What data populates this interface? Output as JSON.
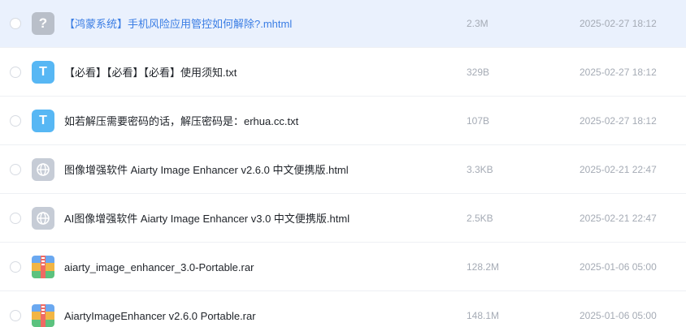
{
  "files": [
    {
      "name": "【鸿蒙系统】手机风险应用管控如何解除?.mhtml",
      "size": "2.3M",
      "date": "2025-02-27 18:12",
      "icon": "unknown-file-icon",
      "selected": true
    },
    {
      "name": "【必看】【必看】【必看】使用须知.txt",
      "size": "329B",
      "date": "2025-02-27 18:12",
      "icon": "text-file-icon",
      "selected": false
    },
    {
      "name": "如若解压需要密码的话，解压密码是：erhua.cc.txt",
      "size": "107B",
      "date": "2025-02-27 18:12",
      "icon": "text-file-icon",
      "selected": false
    },
    {
      "name": "图像增强软件 Aiarty Image Enhancer v2.6.0 中文便携版.html",
      "size": "3.3KB",
      "date": "2025-02-21 22:47",
      "icon": "web-file-icon",
      "selected": false
    },
    {
      "name": "AI图像增强软件 Aiarty Image Enhancer v3.0 中文便携版.html",
      "size": "2.5KB",
      "date": "2025-02-21 22:47",
      "icon": "web-file-icon",
      "selected": false
    },
    {
      "name": "aiarty_image_enhancer_3.0-Portable.rar",
      "size": "128.2M",
      "date": "2025-01-06 05:00",
      "icon": "archive-file-icon",
      "selected": false
    },
    {
      "name": "AiartyImageEnhancer v2.6.0 Portable.rar",
      "size": "148.1M",
      "date": "2025-01-06 05:00",
      "icon": "archive-file-icon",
      "selected": false
    }
  ],
  "icon_glyphs": {
    "unknown": "?",
    "text": "T"
  },
  "colors": {
    "selected_row": "#eaf1fd",
    "selected_text": "#3a7de4",
    "meta_text": "#a5abb5",
    "text_icon": "#57b7f4"
  }
}
